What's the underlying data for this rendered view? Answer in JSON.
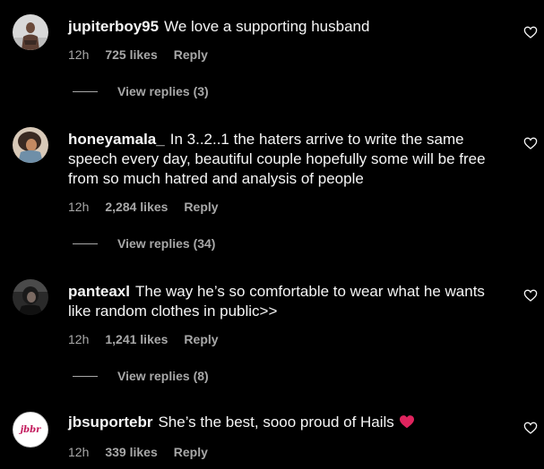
{
  "comments": [
    {
      "username": "jupiterboy95",
      "text": "We love a supporting husband",
      "time": "12h",
      "likes": "725 likes",
      "reply_label": "Reply",
      "view_replies": "View replies (3)"
    },
    {
      "username": "honeyamala_",
      "text": "In 3..2..1 the haters arrive to write the same speech every day, beautiful couple hopefully some will be free from so much hatred and analysis of people",
      "time": "12h",
      "likes": "2,284 likes",
      "reply_label": "Reply",
      "view_replies": "View replies (34)"
    },
    {
      "username": "panteaxl",
      "text": "The way he’s so comfortable to wear what he wants like random clothes in public>>",
      "time": "12h",
      "likes": "1,241 likes",
      "reply_label": "Reply",
      "view_replies": "View replies (8)"
    },
    {
      "username": "jbsuportebr",
      "text": "She’s the best, sooo proud of Hails",
      "time": "12h",
      "likes": "339 likes",
      "reply_label": "Reply",
      "avatar_text": "jbbr"
    }
  ],
  "colors": {
    "background": "#000000",
    "text": "#f5f5f5",
    "muted": "#a8a8a8",
    "heart_emoji": "#e0245e"
  },
  "icons": {
    "like": "heart-outline-icon",
    "emoji": "red-heart-emoji"
  }
}
